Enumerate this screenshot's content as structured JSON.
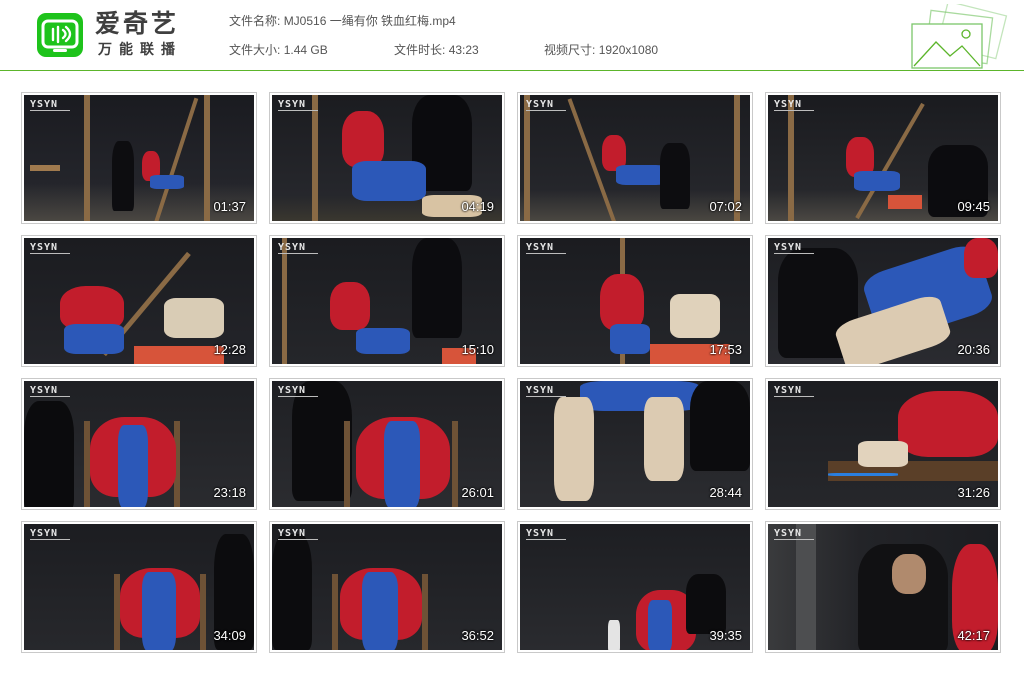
{
  "brand": {
    "name": "爱奇艺",
    "tagline": "万能联播",
    "accent_color": "#1ec31b",
    "logo_icon": "iqiyi-tv-logo-icon"
  },
  "file_info": {
    "name_label": "文件名称:",
    "name_value": "MJ0516 一绳有你 铁血红梅.mp4",
    "size_label": "文件大小:",
    "size_value": "1.44 GB",
    "duration_label": "文件时长:",
    "duration_value": "43:23",
    "resolution_label": "视频尺寸:",
    "resolution_value": "1920x1080"
  },
  "thumbnails": [
    {
      "time": "01:37",
      "watermark": "YSYN"
    },
    {
      "time": "04:19",
      "watermark": "YSYN"
    },
    {
      "time": "07:02",
      "watermark": "YSYN"
    },
    {
      "time": "09:45",
      "watermark": "YSYN"
    },
    {
      "time": "12:28",
      "watermark": "YSYN"
    },
    {
      "time": "15:10",
      "watermark": "YSYN"
    },
    {
      "time": "17:53",
      "watermark": "YSYN"
    },
    {
      "time": "20:36",
      "watermark": "YSYN"
    },
    {
      "time": "23:18",
      "watermark": "YSYN"
    },
    {
      "time": "26:01",
      "watermark": "YSYN"
    },
    {
      "time": "28:44",
      "watermark": "YSYN"
    },
    {
      "time": "31:26",
      "watermark": "YSYN"
    },
    {
      "time": "34:09",
      "watermark": "YSYN"
    },
    {
      "time": "36:52",
      "watermark": "YSYN"
    },
    {
      "time": "39:35",
      "watermark": "YSYN"
    },
    {
      "time": "42:17",
      "watermark": "YSYN"
    }
  ]
}
